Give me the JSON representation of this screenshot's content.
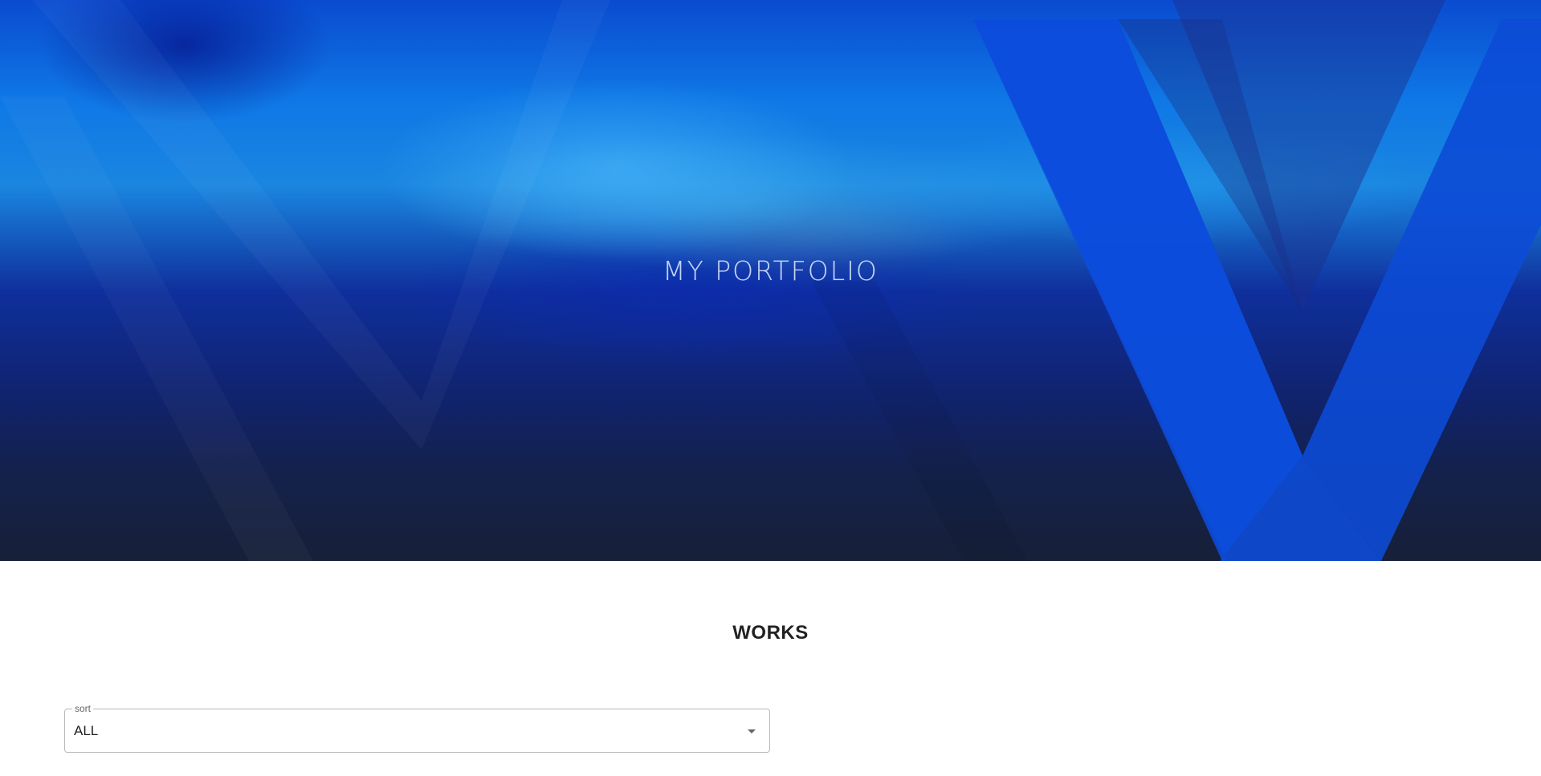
{
  "hero": {
    "title": "MY PORTFOLIO",
    "logo_icon": "v-logo-icon",
    "colors": {
      "deep_blue": "#0a2a9a",
      "bright_blue": "#0f78e6",
      "navy": "#172038"
    }
  },
  "works": {
    "title": "WORKS",
    "sort": {
      "label": "sort",
      "value": "ALL",
      "arrow_icon": "arrow-drop-down-icon"
    }
  }
}
